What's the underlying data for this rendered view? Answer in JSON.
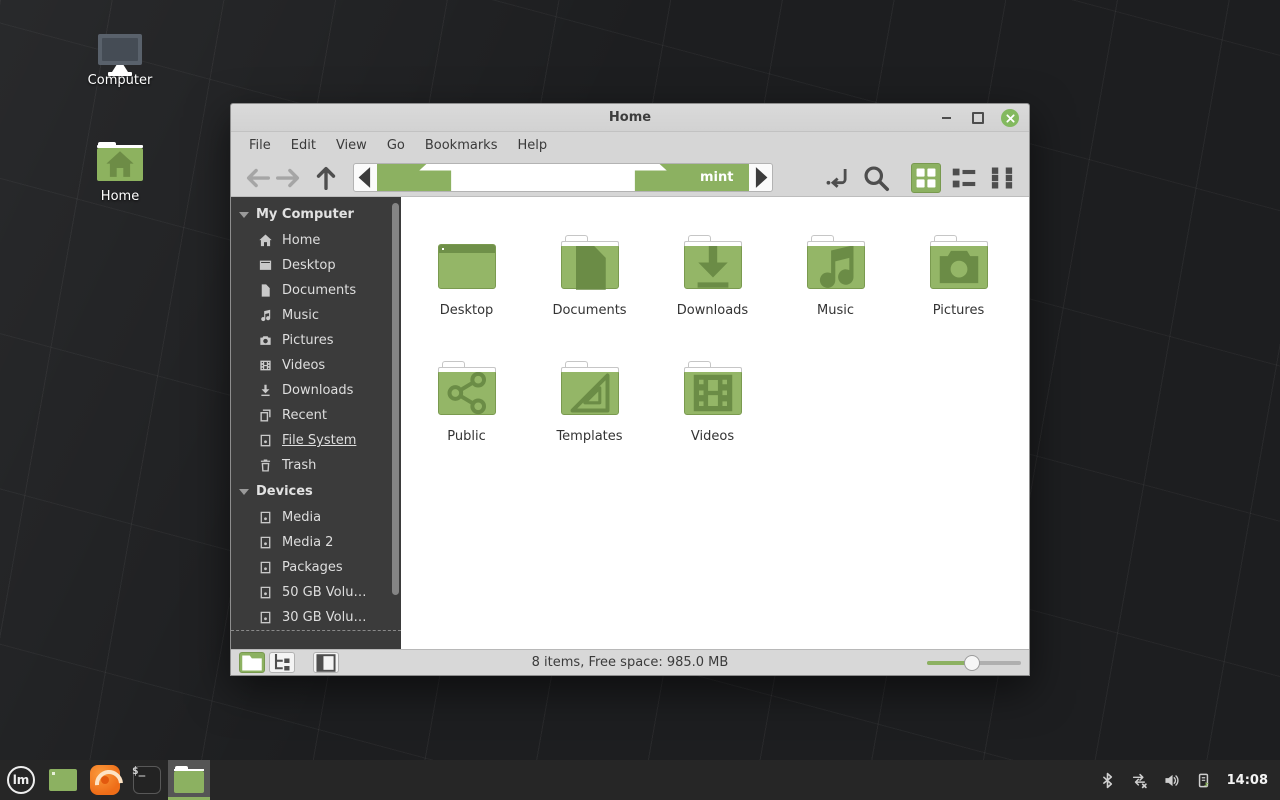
{
  "colors": {
    "accent_green": "#8cb161",
    "folder_green": "#94b667",
    "sidebar_bg": "#3b3b3b",
    "taskbar_bg": "#262626",
    "desktop_bg": "#1d1e20"
  },
  "desktop": {
    "icons": [
      {
        "label": "Computer",
        "icon": "computer"
      },
      {
        "label": "Home",
        "icon": "home-folder"
      }
    ]
  },
  "window": {
    "title": "Home",
    "controls": {
      "minimize": "minimize",
      "maximize": "maximize",
      "close": "close"
    },
    "menubar": [
      {
        "label": "File"
      },
      {
        "label": "Edit"
      },
      {
        "label": "View"
      },
      {
        "label": "Go"
      },
      {
        "label": "Bookmarks"
      },
      {
        "label": "Help"
      }
    ],
    "toolbar": {
      "breadcrumb": {
        "label": "mint",
        "icon": "home"
      },
      "views": [
        {
          "name": "grid-view",
          "icon": "grid",
          "active": true
        },
        {
          "name": "list-view",
          "icon": "list",
          "active": false
        },
        {
          "name": "compact-view",
          "icon": "compact",
          "active": false
        }
      ]
    },
    "sidebar": {
      "sections": [
        {
          "label": "My Computer",
          "items": [
            {
              "label": "Home",
              "icon": "home"
            },
            {
              "label": "Desktop",
              "icon": "desktop"
            },
            {
              "label": "Documents",
              "icon": "document"
            },
            {
              "label": "Music",
              "icon": "music"
            },
            {
              "label": "Pictures",
              "icon": "camera"
            },
            {
              "label": "Videos",
              "icon": "film"
            },
            {
              "label": "Downloads",
              "icon": "download"
            },
            {
              "label": "Recent",
              "icon": "recent"
            },
            {
              "label": "File System",
              "icon": "drive",
              "underlined": true
            },
            {
              "label": "Trash",
              "icon": "trash"
            }
          ]
        },
        {
          "label": "Devices",
          "items": [
            {
              "label": "Media",
              "icon": "drive"
            },
            {
              "label": "Media 2",
              "icon": "drive"
            },
            {
              "label": "Packages",
              "icon": "drive"
            },
            {
              "label": "50 GB Volu…",
              "icon": "drive"
            },
            {
              "label": "30 GB Volu…",
              "icon": "drive",
              "cut": true
            }
          ]
        }
      ]
    },
    "files": [
      {
        "label": "Desktop",
        "icon": "",
        "window": true
      },
      {
        "label": "Documents",
        "icon": "document"
      },
      {
        "label": "Downloads",
        "icon": "download"
      },
      {
        "label": "Music",
        "icon": "music"
      },
      {
        "label": "Pictures",
        "icon": "camera"
      },
      {
        "label": "Public",
        "icon": "share"
      },
      {
        "label": "Templates",
        "icon": "template"
      },
      {
        "label": "Videos",
        "icon": "film"
      }
    ],
    "statusbar": {
      "text": "8 items, Free space: 985.0 MB",
      "toggles": [
        {
          "name": "show-places",
          "icon": "places",
          "active": true
        },
        {
          "name": "show-treeview",
          "icon": "tree",
          "active": false
        },
        {
          "name": "hide-sidebar",
          "icon": "sidebar-toggle",
          "active": false,
          "gap": true
        }
      ]
    }
  },
  "taskbar": {
    "launchers": [
      {
        "name": "mint-menu",
        "glyph": "lm",
        "active": false
      },
      {
        "name": "show-desktop",
        "glyph": "",
        "active": false
      },
      {
        "name": "firefox",
        "glyph": "",
        "active": false
      },
      {
        "name": "terminal",
        "glyph": "$_",
        "active": false
      },
      {
        "name": "files",
        "glyph": "",
        "active": true
      }
    ],
    "tray": [
      {
        "icon": "bluetooth"
      },
      {
        "icon": "network"
      },
      {
        "icon": "volume"
      },
      {
        "icon": "battery"
      }
    ],
    "clock": "14:08"
  }
}
